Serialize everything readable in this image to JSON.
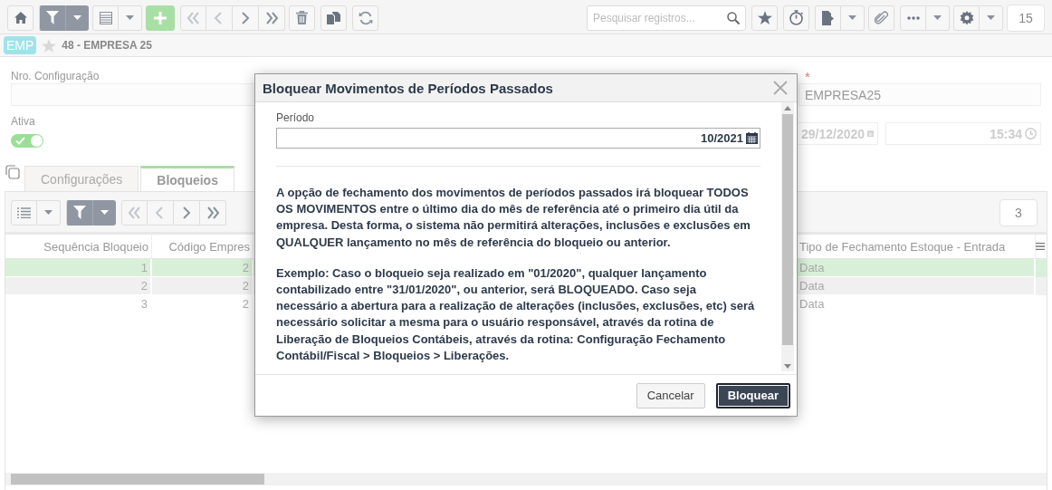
{
  "toolbar": {
    "filter_active": true,
    "nav_buttons": [
      {
        "disabled": true
      },
      {
        "disabled": true
      },
      {
        "disabled": false
      },
      {
        "disabled": false
      }
    ],
    "search": {
      "placeholder": "Pesquisar registros..."
    },
    "record_count": "15"
  },
  "breadcrumb": {
    "badge": "EMP",
    "favorite": false,
    "title": "48 - EMPRESA 25"
  },
  "form": {
    "config_label": "Nro. Configuração",
    "active_label": "Ativa",
    "active": {
      "on": true
    },
    "required_mark": "*",
    "company_code": "EMPRESA25",
    "date": "29/12/2020",
    "time": "15:34"
  },
  "tabs": [
    {
      "label": "Configurações",
      "selected": false
    },
    {
      "label": "Bloqueios",
      "selected": true
    }
  ],
  "grid": {
    "filter_active": true,
    "nav_buttons": [
      {
        "disabled": true
      },
      {
        "disabled": true
      },
      {
        "disabled": false
      },
      {
        "disabled": false
      }
    ],
    "count": "3",
    "columns": [
      "Sequência Bloqueio",
      "Código Empres",
      "Tipo de Fechamento Estoque - Entrada"
    ],
    "rows": [
      {
        "cells": [
          "1",
          "2",
          "Data"
        ],
        "selected": true
      },
      {
        "cells": [
          "2",
          "2",
          "Data"
        ],
        "selected": false
      },
      {
        "cells": [
          "3",
          "2",
          "Data"
        ],
        "selected": false
      }
    ]
  },
  "modal": {
    "title": "Bloquear Movimentos de Períodos Passados",
    "field_label": "Período",
    "field_value": "10/2021",
    "paragraphs": [
      "A opção de fechamento dos movimentos de períodos passados irá bloquear TODOS OS MOVIMENTOS entre o último dia do mês de referência até o primeiro dia útil da empresa. Desta forma, o sistema não permitirá alterações, inclusões e exclusões em QUALQUER lançamento no mês de referência do bloqueio ou anterior.",
      "Exemplo: Caso o bloqueio seja realizado em \"01/2020\", qualquer lançamento contabilizado entre \"31/01/2020\", ou anterior, será BLOQUEADO. Caso seja necessário a abertura para a realização de alterações (inclusões, exclusões, etc) será necessário solicitar a mesma para o usuário responsável, através da rotina de Liberação de Bloqueios Contábeis, através da rotina: Configuração Fechamento Contábil/Fiscal > Bloqueios > Liberações."
    ],
    "buttons": [
      {
        "label": "Cancelar",
        "kind": "secondary"
      },
      {
        "label": "Bloquear",
        "kind": "primary"
      }
    ]
  }
}
